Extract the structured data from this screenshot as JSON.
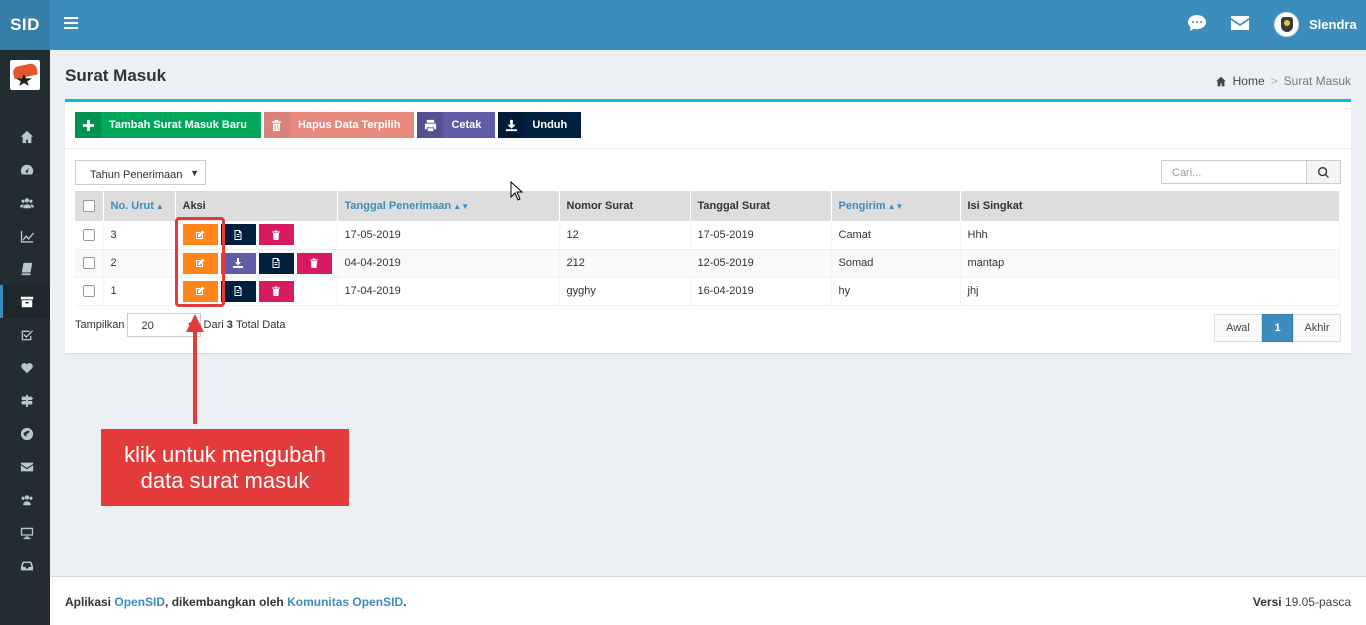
{
  "app": {
    "brand": "SID"
  },
  "header": {
    "user_name": "Slendra"
  },
  "sidebar": {
    "items": [
      {
        "icon": "home-icon"
      },
      {
        "icon": "dashboard-icon"
      },
      {
        "icon": "users-icon"
      },
      {
        "icon": "chart-icon"
      },
      {
        "icon": "book-icon"
      },
      {
        "icon": "archive-icon",
        "active": true
      },
      {
        "icon": "check-square-icon"
      },
      {
        "icon": "heart-icon"
      },
      {
        "icon": "signpost-icon"
      },
      {
        "icon": "globe-icon"
      },
      {
        "icon": "envelope-icon"
      },
      {
        "icon": "users-icon"
      },
      {
        "icon": "desktop-icon"
      },
      {
        "icon": "inbox-icon"
      }
    ]
  },
  "page": {
    "title": "Surat Masuk",
    "breadcrumb": {
      "home": "Home",
      "current": "Surat Masuk"
    }
  },
  "toolbar": {
    "add_label": "Tambah Surat Masuk Baru",
    "delete_label": "Hapus Data Terpilih",
    "print_label": "Cetak",
    "download_label": "Unduh"
  },
  "filter": {
    "year_label": "Tahun Penerimaan"
  },
  "search": {
    "placeholder": "Cari..."
  },
  "table": {
    "headers": {
      "no": "No. Urut",
      "aksi": "Aksi",
      "tanggal_penerimaan": "Tanggal Penerimaan",
      "nomor_surat": "Nomor Surat",
      "tanggal_surat": "Tanggal Surat",
      "pengirim": "Pengirim",
      "isi_singkat": "Isi Singkat"
    },
    "rows": [
      {
        "no": "3",
        "tanggal_penerimaan": "17-05-2019",
        "nomor_surat": "12",
        "tanggal_surat": "17-05-2019",
        "pengirim": "Camat",
        "isi_singkat": "Hhh"
      },
      {
        "no": "2",
        "tanggal_penerimaan": "04-04-2019",
        "nomor_surat": "212",
        "tanggal_surat": "12-05-2019",
        "pengirim": "Somad",
        "isi_singkat": "mantap"
      },
      {
        "no": "1",
        "tanggal_penerimaan": "17-04-2019",
        "nomor_surat": "gyghy",
        "tanggal_surat": "16-04-2019",
        "pengirim": "hy",
        "isi_singkat": "jhj"
      }
    ]
  },
  "paging": {
    "show_label": "Tampilkan",
    "page_size": "20",
    "total_prefix": "Dari",
    "total": "3",
    "total_suffix": "Total Data",
    "first": "Awal",
    "current": "1",
    "last": "Akhir"
  },
  "annotation": {
    "line1": "klik untuk mengubah",
    "line2": "data surat masuk"
  },
  "footer": {
    "left_prefix": "Aplikasi",
    "app_link": "OpenSID",
    "left_middle": ", dikembangkan oleh",
    "community_link": "Komunitas OpenSID",
    "left_suffix": ".",
    "version_label": "Versi",
    "version": "19.05-pasca"
  },
  "colors": {
    "header": "#3c8dbc",
    "sidebar": "#222d32",
    "accent_top": "#00c0ef",
    "annotation": "#e33b3b"
  }
}
